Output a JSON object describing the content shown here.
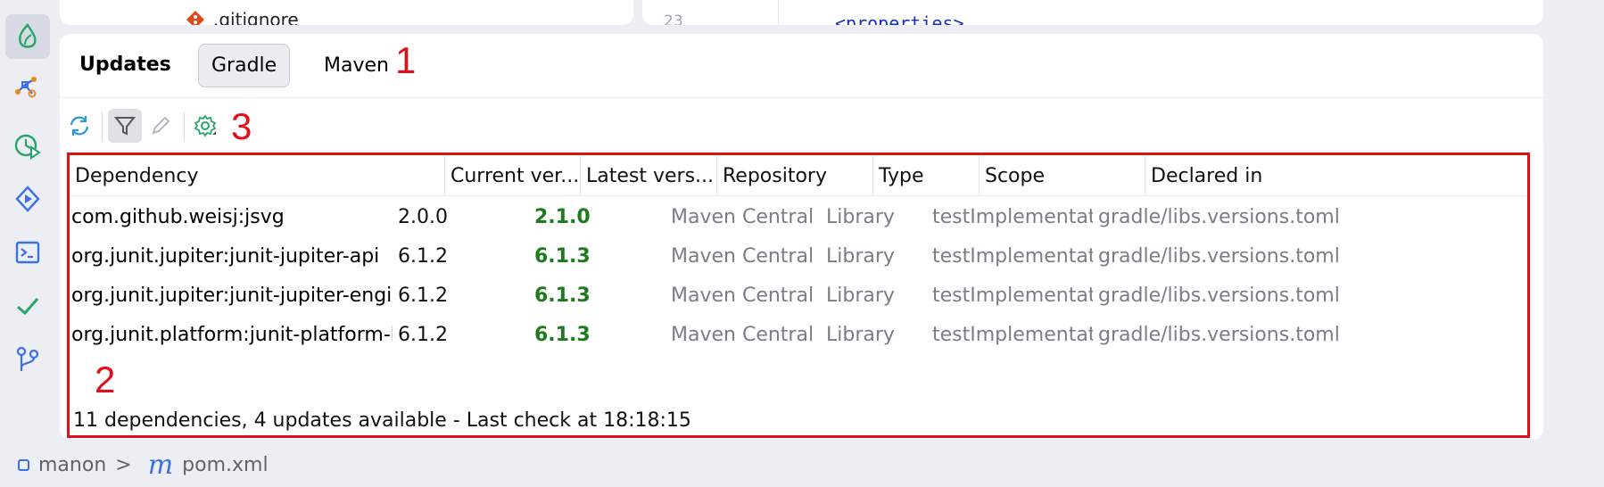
{
  "peek": {
    "file_name": ".gitignore",
    "line_number": "23",
    "code": "<properties>"
  },
  "tabs": {
    "title": "Updates",
    "items": [
      "Gradle",
      "Maven"
    ],
    "selected": "Gradle"
  },
  "annotations": [
    "1",
    "2",
    "3"
  ],
  "toolbar": {
    "refresh_icon": "refresh-icon",
    "filter_icon": "filter-icon",
    "edit_icon": "edit-icon",
    "settings_icon": "settings-icon"
  },
  "table": {
    "columns": [
      "Dependency",
      "Current ver...",
      "Latest vers...",
      "Repository",
      "Type",
      "Scope",
      "Declared in"
    ],
    "rows": [
      {
        "dependency": "com.github.weisj:jsvg",
        "current": "2.0.0",
        "latest": "2.1.0",
        "repository": "Maven Central",
        "type": "Library",
        "scope": "testImplementation",
        "declared_in": "gradle/libs.versions.toml"
      },
      {
        "dependency": "org.junit.jupiter:junit-jupiter-api",
        "current": "6.1.2",
        "latest": "6.1.3",
        "repository": "Maven Central",
        "type": "Library",
        "scope": "testImplementation",
        "declared_in": "gradle/libs.versions.toml"
      },
      {
        "dependency": "org.junit.jupiter:junit-jupiter-engine",
        "current": "6.1.2",
        "latest": "6.1.3",
        "repository": "Maven Central",
        "type": "Library",
        "scope": "testImplementation",
        "declared_in": "gradle/libs.versions.toml"
      },
      {
        "dependency": "org.junit.platform:junit-platform-launcher",
        "current": "6.1.2",
        "latest": "6.1.3",
        "repository": "Maven Central",
        "type": "Library",
        "scope": "testImplementation",
        "declared_in": "gradle/libs.versions.toml"
      }
    ],
    "status": "11 dependencies, 4 updates available - Last check at 18:18:15"
  },
  "breadcrumb": {
    "project": "manon",
    "separator": ">",
    "file_badge": "m",
    "file": "pom.xml"
  },
  "colors": {
    "accent_green": "#1e7a1e",
    "annotation_red": "#e0101a",
    "link_blue": "#3b6fe8"
  }
}
